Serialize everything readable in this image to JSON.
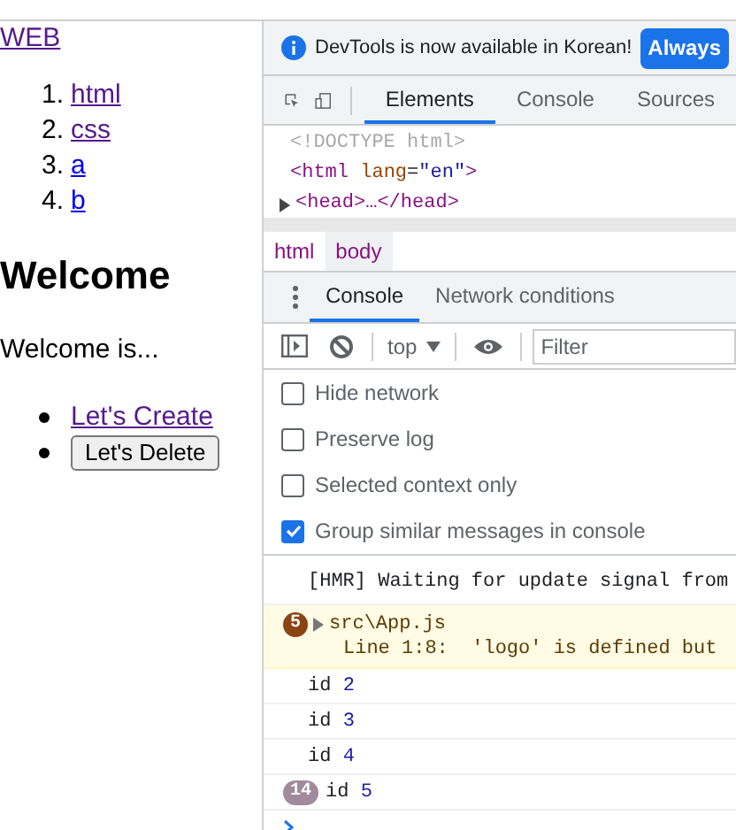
{
  "page": {
    "home_link": {
      "text": "WEB",
      "visited": true
    },
    "topics": [
      {
        "number": "1.",
        "text": "html",
        "visited": true
      },
      {
        "number": "2.",
        "text": "css",
        "visited": true
      },
      {
        "number": "3.",
        "text": "a",
        "visited": false
      },
      {
        "number": "4.",
        "text": "b",
        "visited": false
      }
    ],
    "heading": "Welcome",
    "body": "Welcome is...",
    "actions": [
      {
        "kind": "link",
        "text": "Let's Create"
      },
      {
        "kind": "button",
        "text": "Let's Delete"
      }
    ]
  },
  "devtools": {
    "infobar": {
      "text": "DevTools is now available in Korean!",
      "button": "Always"
    },
    "tabs": [
      {
        "label": "Elements",
        "selected": true
      },
      {
        "label": "Console",
        "selected": false
      },
      {
        "label": "Sources",
        "selected": false
      }
    ],
    "dom_lines": [
      {
        "kind": "doctype",
        "text": "<!DOCTYPE html>"
      },
      {
        "kind": "open",
        "tag": "<html",
        "attr": "lang",
        "eq": "=",
        "value": "\"en\"",
        "close": ">"
      },
      {
        "kind": "collapsed",
        "text": "<head>…</head>"
      }
    ],
    "breadcrumbs": [
      {
        "label": "html",
        "selected": false
      },
      {
        "label": "body",
        "selected": true
      }
    ],
    "drawer_tabs": [
      {
        "label": "Console",
        "selected": true
      },
      {
        "label": "Network conditions",
        "selected": false
      }
    ],
    "context": "top",
    "filter_placeholder": "Filter",
    "settings": [
      {
        "label": "Hide network",
        "checked": false
      },
      {
        "label": "Preserve log",
        "checked": false
      },
      {
        "label": "Selected context only",
        "checked": false
      },
      {
        "label": "Group similar messages in console",
        "checked": true
      }
    ],
    "messages": [
      {
        "kind": "log",
        "text": "[HMR] Waiting for update signal from"
      },
      {
        "kind": "warning",
        "count": "5",
        "source": "src\\App.js",
        "detail": "Line 1:8:  'logo' is defined but"
      },
      {
        "kind": "value",
        "label": "id",
        "value": "2"
      },
      {
        "kind": "value",
        "label": "id",
        "value": "3"
      },
      {
        "kind": "value",
        "label": "id",
        "value": "4"
      },
      {
        "kind": "value",
        "count": "14",
        "label": "id",
        "value": "5"
      }
    ]
  }
}
